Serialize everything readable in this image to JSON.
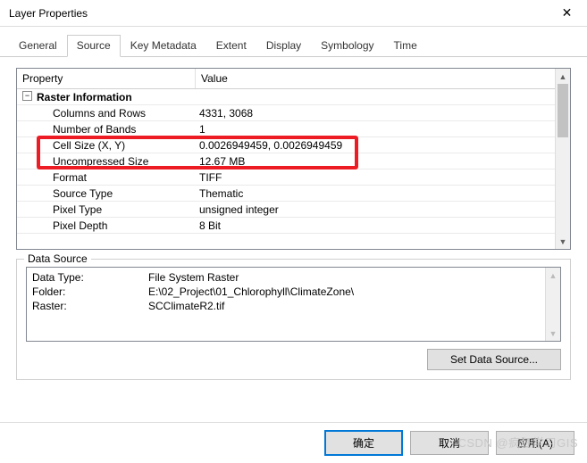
{
  "window": {
    "title": "Layer Properties",
    "close": "✕"
  },
  "tabs": {
    "general": "General",
    "source": "Source",
    "key_metadata": "Key Metadata",
    "extent": "Extent",
    "display": "Display",
    "symbology": "Symbology",
    "time": "Time"
  },
  "grid": {
    "header_property": "Property",
    "header_value": "Value",
    "tree_toggle": "−",
    "group_label": "Raster Information",
    "rows": [
      {
        "label": "Columns and Rows",
        "value": "4331, 3068"
      },
      {
        "label": "Number of Bands",
        "value": "1"
      },
      {
        "label": "Cell Size (X, Y)",
        "value": "0.0026949459, 0.0026949459"
      },
      {
        "label": "Uncompressed Size",
        "value": "12.67 MB"
      },
      {
        "label": "Format",
        "value": "TIFF"
      },
      {
        "label": "Source Type",
        "value": "Thematic"
      },
      {
        "label": "Pixel Type",
        "value": "unsigned integer"
      },
      {
        "label": "Pixel Depth",
        "value": "8 Bit"
      }
    ]
  },
  "data_source": {
    "legend": "Data Source",
    "data_type_label": "Data Type:",
    "data_type_value": "File System Raster",
    "folder_label": "Folder:",
    "folder_value": "E:\\02_Project\\01_Chlorophyll\\ClimateZone\\",
    "raster_label": "Raster:",
    "raster_value": "SCClimateR2.tif",
    "set_button": "Set Data Source..."
  },
  "footer": {
    "ok": "确定",
    "cancel": "取消",
    "apply": "应用(A)"
  },
  "watermark": "CSDN @疯狂学习GIS"
}
